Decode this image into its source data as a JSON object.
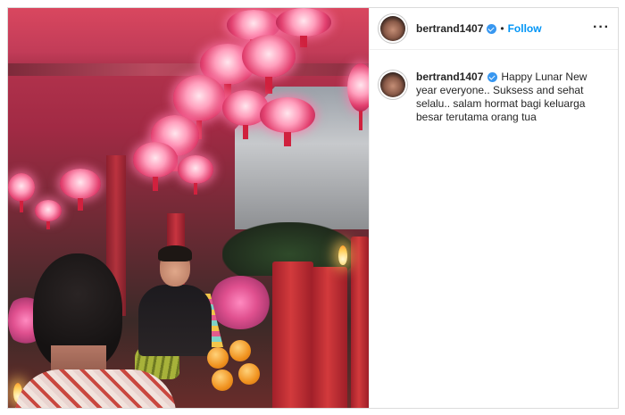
{
  "post": {
    "username": "bertrand1407",
    "verified": true,
    "separator": "•",
    "follow_label": "Follow",
    "more_icon": "more-horizontal-icon",
    "more_glyph": "···",
    "caption": "Happy Lunar New year everyone.. Suksess and sehat selalu.. salam hormat bagi keluarga besar terutama orang tua"
  },
  "colors": {
    "follow": "#0095f6",
    "verified_badge": "#3897f0",
    "border": "#dbdbdb"
  }
}
